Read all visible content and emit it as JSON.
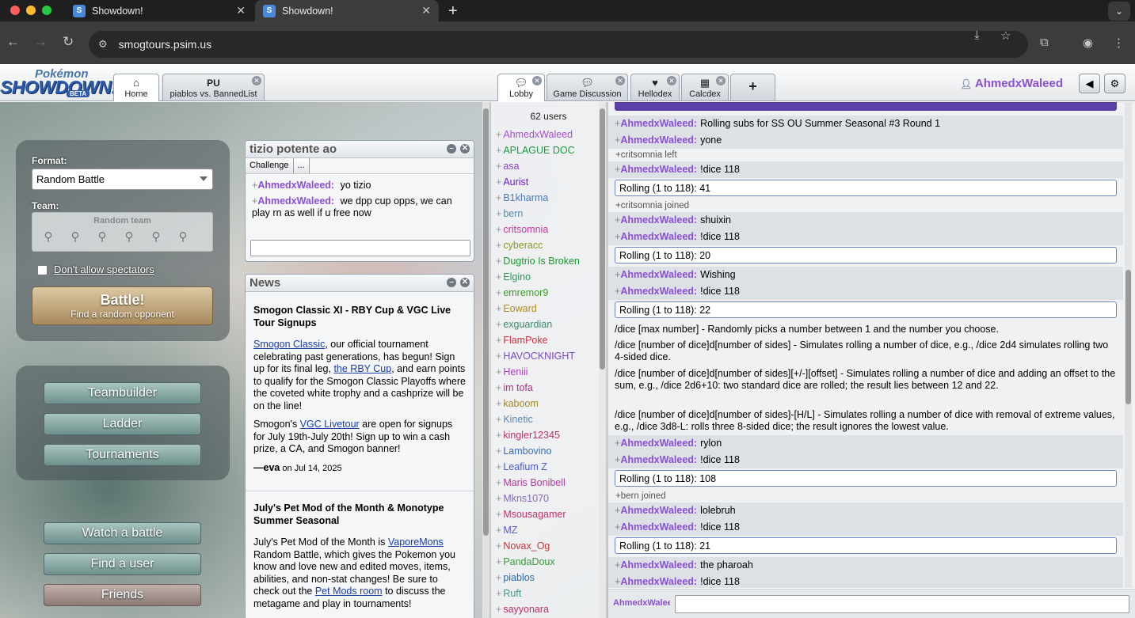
{
  "browser": {
    "tabs": [
      {
        "title": "Showdown!",
        "active": false
      },
      {
        "title": "Showdown!",
        "active": true
      }
    ],
    "url": "smogtours.psim.us"
  },
  "header": {
    "logo_top": "Pokémon",
    "logo_main": "SHOWDOWN!",
    "logo_badge": "BETA",
    "left_tabs": [
      {
        "icon": "home-icon",
        "label": "Home"
      },
      {
        "title": "PU",
        "label": "piablos vs. BannedList"
      }
    ],
    "room_tabs": [
      {
        "label": "Lobby"
      },
      {
        "label": "Game Discussion"
      },
      {
        "label": "Hellodex"
      },
      {
        "label": "Calcdex"
      }
    ],
    "add_tab": "+",
    "username": "AhmedxWaleed"
  },
  "battle_panel": {
    "format_label": "Format:",
    "format_value": "Random Battle",
    "team_label": "Team:",
    "team_value": "Random team",
    "spectators_label": "Don't allow spectators",
    "battle_title": "Battle!",
    "battle_sub": "Find a random opponent"
  },
  "menu_buttons": {
    "teambuilder": "Teambuilder",
    "ladder": "Ladder",
    "tournaments": "Tournaments",
    "watch": "Watch a battle",
    "find_user": "Find a user",
    "friends": "Friends"
  },
  "pm": {
    "title": "tizio potente ao",
    "challenge": "Challenge",
    "more": "...",
    "messages": [
      {
        "group": "+",
        "user": "AhmedxWaleed:",
        "text": "yo tizio"
      },
      {
        "group": "+",
        "user": "AhmedxWaleed:",
        "text": "we dpp cup opps, we can play rn as well if u free now"
      }
    ]
  },
  "news": {
    "title": "News",
    "items": [
      {
        "headline": "Smogon Classic XI - RBY Cup & VGC Live Tour Signups",
        "p1_link1": "Smogon Classic",
        "p1_a": ", our official tournament celebrating past generations, has begun! Sign up for its final leg, ",
        "p1_link2": "the RBY Cup",
        "p1_b": ", and earn points to qualify for the Smogon Classic Playoffs where the coveted white trophy and a cashprize will be on the line!",
        "p2_a": "Smogon's ",
        "p2_link": "VGC Livetour",
        "p2_b": " are open for signups for July 19th-July 20th! Sign up to win a cash prize, a CA, and Smogon banner!",
        "dash": "—",
        "author": "eva",
        "date": " on Jul 14, 2025"
      },
      {
        "headline": "July's Pet Mod of the Month & Monotype Summer Seasonal",
        "p1_a": "July's Pet Mod of the Month is ",
        "p1_link": "VaporeMons",
        "p1_b": " Random Battle, which gives the Pokemon you know and love new and edited moves, items, abilities, and non-stat changes! Be sure to check out the ",
        "p1_link2": "Pet Mods room",
        "p1_c": " to discuss the metagame and play in tournaments!"
      }
    ]
  },
  "userlist": {
    "count": "62 users",
    "users": [
      {
        "name": "AhmedxWaleed",
        "color": "#a54fd0"
      },
      {
        "name": "APLAGUE DOC",
        "color": "#1c9a3c"
      },
      {
        "name": "asa",
        "color": "#8a3fc8"
      },
      {
        "name": "Aurist",
        "color": "#6a1fc0"
      },
      {
        "name": "B1kharma",
        "color": "#4a7ab8"
      },
      {
        "name": "bern",
        "color": "#5a8aa8"
      },
      {
        "name": "critsomnia",
        "color": "#c2399c"
      },
      {
        "name": "cyberacc",
        "color": "#8a9a1c"
      },
      {
        "name": "Dugtrio Is Broken",
        "color": "#1a9a2c"
      },
      {
        "name": "Elgino",
        "color": "#2a9a5c"
      },
      {
        "name": "emremor9",
        "color": "#3a9a2a"
      },
      {
        "name": "Eoward",
        "color": "#b08a1c"
      },
      {
        "name": "exguardian",
        "color": "#3a8a6a"
      },
      {
        "name": "FlamPoke",
        "color": "#d0303a"
      },
      {
        "name": "HAVOCKNIGHT",
        "color": "#7a4ac0"
      },
      {
        "name": "Heniii",
        "color": "#b03ac0"
      },
      {
        "name": "im tofa",
        "color": "#b0308a"
      },
      {
        "name": "kaboom",
        "color": "#a08a2a"
      },
      {
        "name": "Kinetic",
        "color": "#5a8ab8"
      },
      {
        "name": "kingler12345",
        "color": "#c0306a"
      },
      {
        "name": "Lambovino",
        "color": "#3a6ab8"
      },
      {
        "name": "Leafium Z",
        "color": "#4a5ad0"
      },
      {
        "name": "Maris Bonibell",
        "color": "#b03aa0"
      },
      {
        "name": "Mkns1070",
        "color": "#8a6ac0"
      },
      {
        "name": "Msousagamer",
        "color": "#c0306a"
      },
      {
        "name": "MZ",
        "color": "#5a5ad0"
      },
      {
        "name": "Novax_Og",
        "color": "#c03a3a"
      },
      {
        "name": "PandaDoux",
        "color": "#3a9a3a"
      },
      {
        "name": "piablos",
        "color": "#2a6ab0"
      },
      {
        "name": "Ruft",
        "color": "#3a9a8a"
      },
      {
        "name": "sayyonara",
        "color": "#c0306a"
      }
    ]
  },
  "chat": {
    "lines": [
      {
        "type": "msg",
        "group": "+",
        "user": "AhmedxWaleed:",
        "text": "Rolling subs for SS OU Summer Seasonal #3 Round 1"
      },
      {
        "type": "msg",
        "group": "+",
        "user": "AhmedxWaleed:",
        "text": "yone"
      },
      {
        "type": "note",
        "text": "+critsomnia left"
      },
      {
        "type": "msg",
        "group": "+",
        "user": "AhmedxWaleed:",
        "text": "!dice 118"
      },
      {
        "type": "roll",
        "text": "Rolling (1 to 118): 41"
      },
      {
        "type": "note",
        "text": "+critsomnia joined"
      },
      {
        "type": "msg",
        "group": "+",
        "user": "AhmedxWaleed:",
        "text": "shuixin"
      },
      {
        "type": "msg",
        "group": "+",
        "user": "AhmedxWaleed:",
        "text": "!dice 118"
      },
      {
        "type": "roll",
        "text": "Rolling (1 to 118): 20"
      },
      {
        "type": "msg",
        "group": "+",
        "user": "AhmedxWaleed:",
        "text": "Wishing"
      },
      {
        "type": "msg",
        "group": "+",
        "user": "AhmedxWaleed:",
        "text": "!dice 118"
      },
      {
        "type": "roll",
        "text": "Rolling (1 to 118): 22"
      },
      {
        "type": "help",
        "text": "/dice [max number] - Randomly picks a number between 1 and the number you choose."
      },
      {
        "type": "help",
        "text": "/dice [number of dice]d[number of sides] - Simulates rolling a number of dice, e.g., /dice 2d4 simulates rolling two 4-sided dice."
      },
      {
        "type": "help",
        "text": "/dice [number of dice]d[number of sides][+/-][offset] - Simulates rolling a number of dice and adding an offset to the sum, e.g., /dice 2d6+10: two standard dice are rolled; the result lies between 12 and 22."
      },
      {
        "type": "help",
        "text": "/dice [number of dice]d[number of sides]-[H/L] - Simulates rolling a number of dice with removal of extreme values, e.g., /dice 3d8-L: rolls three 8-sided dice; the result ignores the lowest value."
      },
      {
        "type": "msg",
        "group": "+",
        "user": "AhmedxWaleed:",
        "text": "rylon"
      },
      {
        "type": "msg",
        "group": "+",
        "user": "AhmedxWaleed:",
        "text": "!dice 118"
      },
      {
        "type": "roll",
        "text": "Rolling (1 to 118): 108"
      },
      {
        "type": "note",
        "text": "+bern joined"
      },
      {
        "type": "msg",
        "group": "+",
        "user": "AhmedxWaleed:",
        "text": "lolebruh"
      },
      {
        "type": "msg",
        "group": "+",
        "user": "AhmedxWaleed:",
        "text": "!dice 118"
      },
      {
        "type": "roll",
        "text": "Rolling (1 to 118): 21"
      },
      {
        "type": "msg",
        "group": "+",
        "user": "AhmedxWaleed:",
        "text": "the pharoah"
      },
      {
        "type": "msg",
        "group": "+",
        "user": "AhmedxWaleed:",
        "text": "!dice 118"
      }
    ],
    "input_user": "AhmedxWaleed"
  }
}
